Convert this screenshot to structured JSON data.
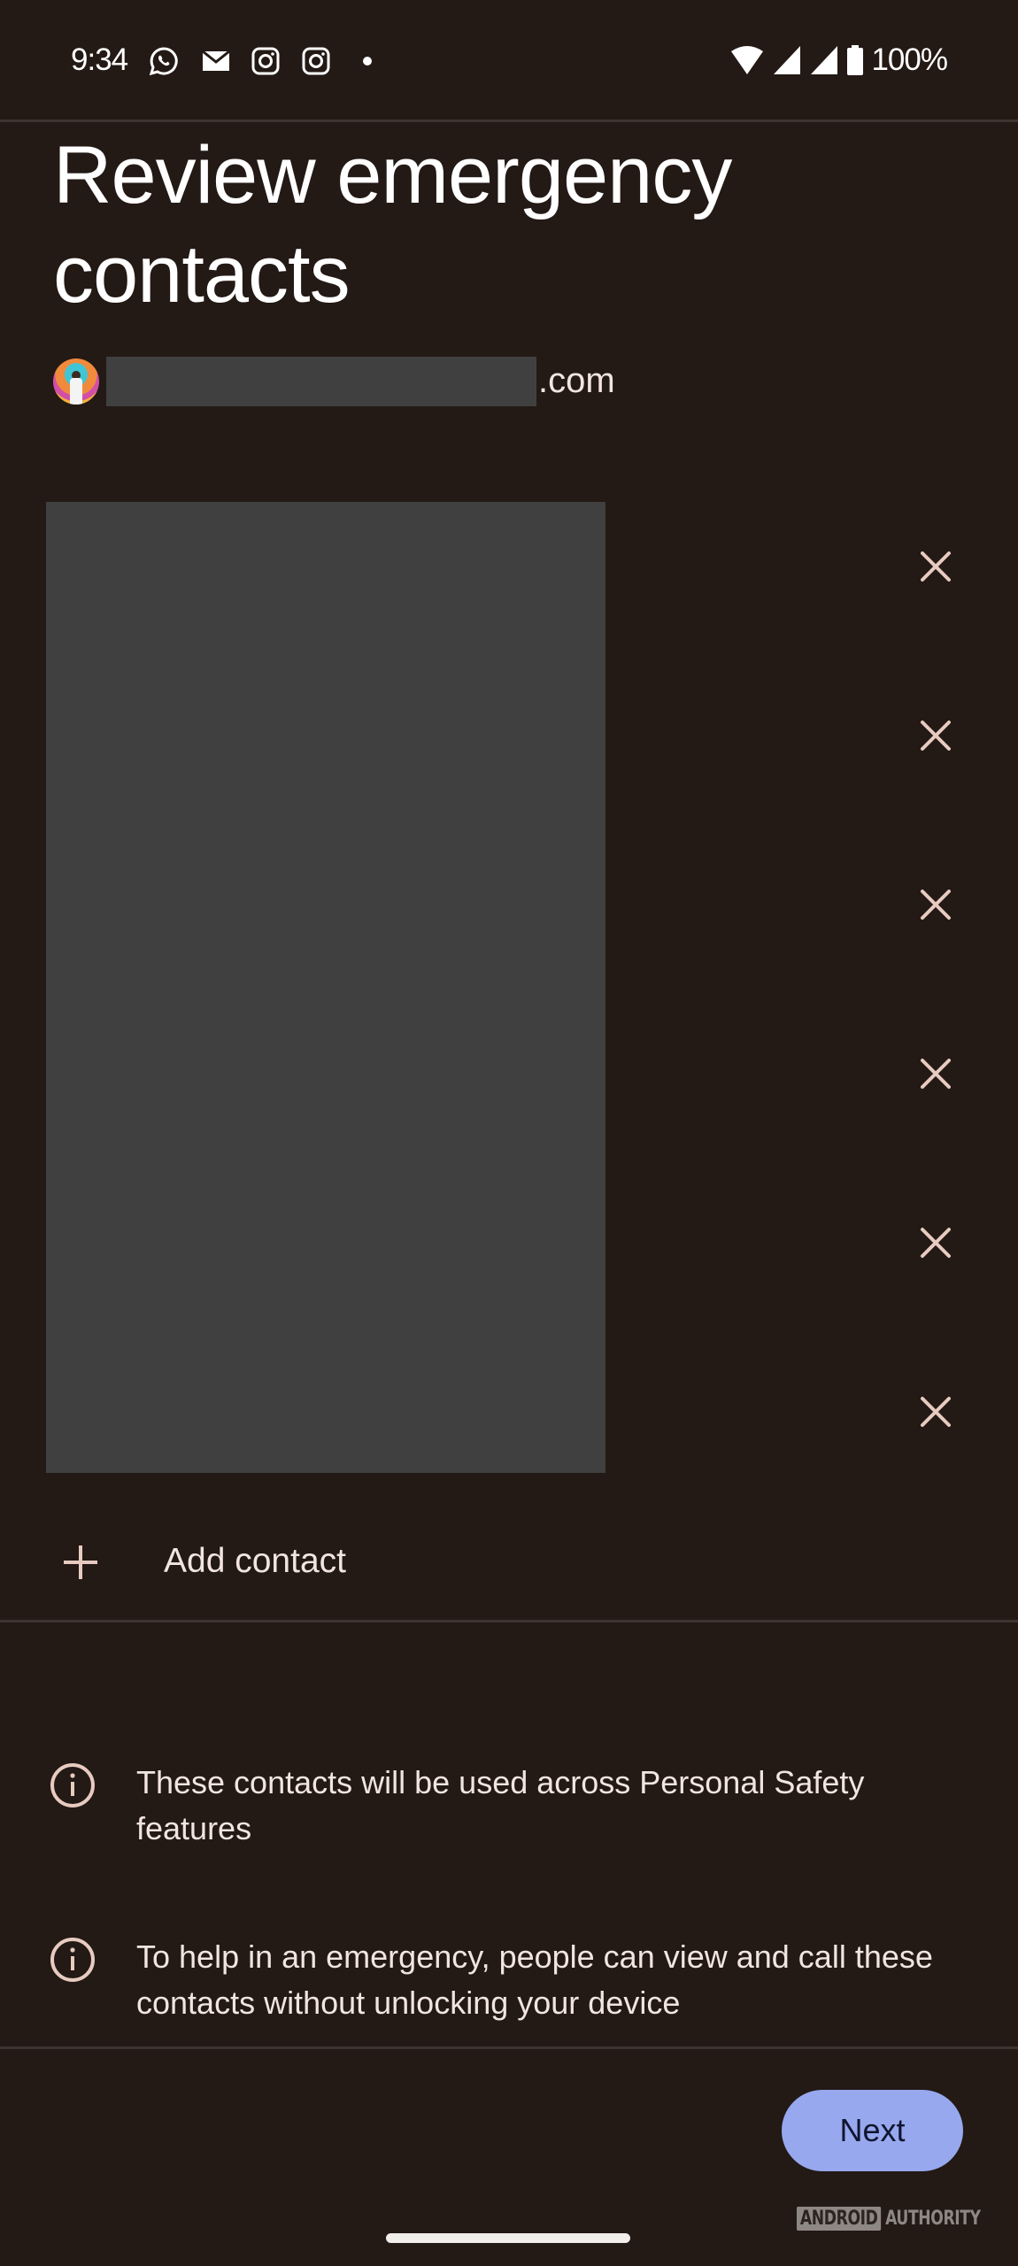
{
  "status_bar": {
    "time": "9:34",
    "notification_icons": [
      "whatsapp-icon",
      "gmail-icon",
      "instagram-icon",
      "instagram-icon",
      "more-notifications-dot-icon"
    ],
    "system_icons": [
      "wifi-icon",
      "cell-signal-icon",
      "cell-signal-icon",
      "battery-icon"
    ],
    "battery": "100%"
  },
  "header": {
    "title": "Review emergency contacts"
  },
  "account": {
    "email_suffix": ".com",
    "email_redacted": true
  },
  "contacts": {
    "redacted": true,
    "count": 6,
    "remove_icon": "close-icon"
  },
  "add_contact": {
    "label": "Add contact",
    "icon": "plus-icon"
  },
  "info": [
    {
      "icon": "info-icon",
      "text": "These contacts will be used across Personal Safety features"
    },
    {
      "icon": "info-icon",
      "text": "To help in an emergency, people can view and call these contacts without unlocking your device"
    }
  ],
  "footer": {
    "next_label": "Next"
  },
  "watermark": {
    "boxed": "ANDROID",
    "text": "AUTHORITY"
  },
  "colors": {
    "background": "#231915",
    "accent_button": "#97a8ee",
    "icon_tint": "#e8cbc0",
    "redaction": "#404040"
  }
}
